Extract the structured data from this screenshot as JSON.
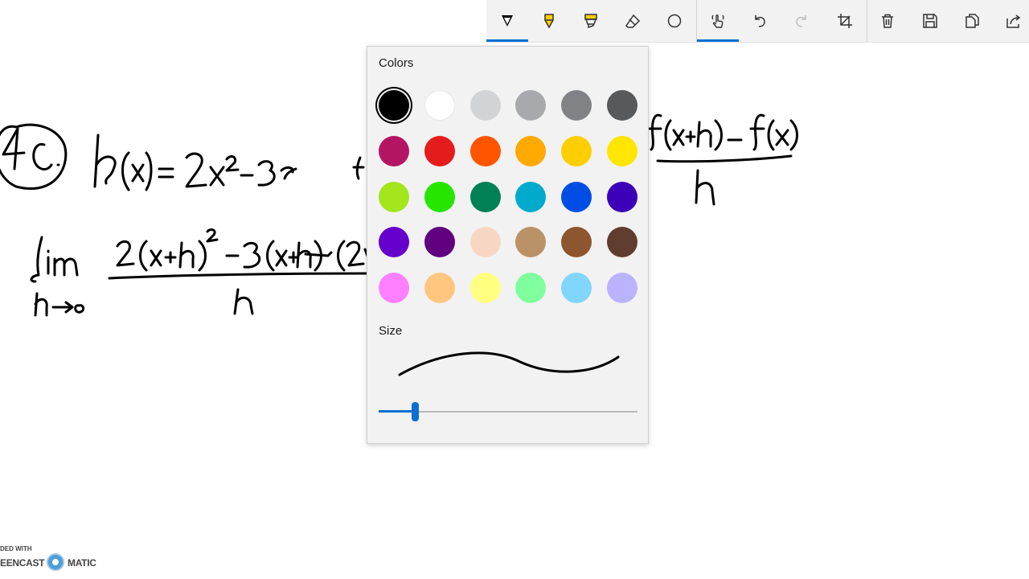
{
  "toolbar": {
    "tools": [
      {
        "name": "ballpoint-pen-tool",
        "icon": "ballpoint-pen-icon"
      },
      {
        "name": "pencil-tool",
        "icon": "pencil-icon"
      },
      {
        "name": "highlighter-tool",
        "icon": "highlighter-icon"
      },
      {
        "name": "eraser-tool",
        "icon": "eraser-icon"
      },
      {
        "name": "ruler-tool",
        "icon": "ruler-icon"
      },
      {
        "name": "touch-writing-toggle",
        "icon": "touch-writing-icon"
      },
      {
        "name": "undo-button",
        "icon": "undo-icon"
      },
      {
        "name": "redo-button",
        "icon": "redo-icon"
      },
      {
        "name": "crop-button",
        "icon": "crop-icon"
      },
      {
        "name": "delete-button",
        "icon": "trash-icon"
      },
      {
        "name": "save-button",
        "icon": "save-icon"
      },
      {
        "name": "copy-button",
        "icon": "copy-icon"
      },
      {
        "name": "share-button",
        "icon": "share-icon"
      }
    ],
    "accent": "#0a6fd1"
  },
  "color_panel": {
    "colors_label": "Colors",
    "size_label": "Size",
    "selected_color": "#000000",
    "swatches": [
      "#000000",
      "#ffffff",
      "#d1d3d4",
      "#a7a9ac",
      "#808285",
      "#58595b",
      "#b31564",
      "#e61b1b",
      "#ff5500",
      "#ffaa00",
      "#ffce00",
      "#ffe600",
      "#a2e61b",
      "#26e600",
      "#008055",
      "#00aacc",
      "#004de6",
      "#3d00b8",
      "#6600cc",
      "#600080",
      "#f7d7c4",
      "#bb9167",
      "#8e562e",
      "#613d30",
      "#ff80ff",
      "#ffc680",
      "#ffff80",
      "#80ff9e",
      "#80d6ff",
      "#bcb3ff"
    ],
    "size_value": 0.14
  },
  "canvas": {
    "ink_color": "#000000"
  },
  "watermark": {
    "top_text": "DED WITH",
    "left_text": "EENCAST",
    "right_text": "MATIC"
  }
}
